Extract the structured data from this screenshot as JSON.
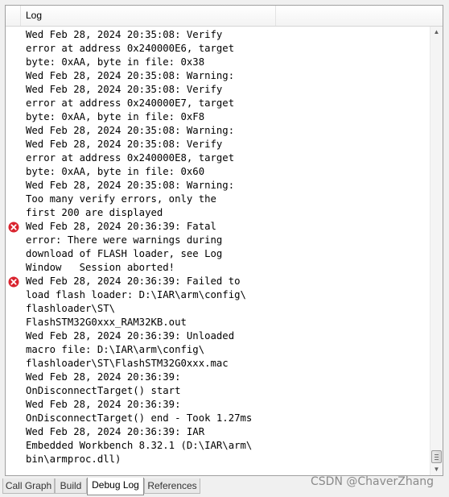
{
  "header": {
    "column_title": "Log"
  },
  "log": {
    "lines": [
      "Wed Feb 28, 2024 20:35:08: Verify",
      "error at address 0x240000E6, target",
      "byte: 0xAA, byte in file: 0x38",
      "Wed Feb 28, 2024 20:35:08: Warning:",
      "Wed Feb 28, 2024 20:35:08: Verify",
      "error at address 0x240000E7, target",
      "byte: 0xAA, byte in file: 0xF8",
      "Wed Feb 28, 2024 20:35:08: Warning:",
      "Wed Feb 28, 2024 20:35:08: Verify",
      "error at address 0x240000E8, target",
      "byte: 0xAA, byte in file: 0x60",
      "Wed Feb 28, 2024 20:35:08: Warning:",
      "Too many verify errors, only the",
      "first 200 are displayed",
      "Wed Feb 28, 2024 20:36:39: Fatal",
      "error: There were warnings during",
      "download of FLASH loader, see Log",
      "Window   Session aborted!",
      "Wed Feb 28, 2024 20:36:39: Failed to",
      "load flash loader: D:\\IAR\\arm\\config\\",
      "flashloader\\ST\\",
      "FlashSTM32G0xxx_RAM32KB.out",
      "Wed Feb 28, 2024 20:36:39: Unloaded",
      "macro file: D:\\IAR\\arm\\config\\",
      "flashloader\\ST\\FlashSTM32G0xxx.mac",
      "Wed Feb 28, 2024 20:36:39:",
      "OnDisconnectTarget() start",
      "Wed Feb 28, 2024 20:36:39:",
      "OnDisconnectTarget() end - Took 1.27ms",
      "Wed Feb 28, 2024 20:36:39: IAR",
      "Embedded Workbench 8.32.1 (D:\\IAR\\arm\\",
      "bin\\armproc.dll)"
    ],
    "error_icon_lines": [
      14,
      18
    ],
    "error_icon_name": "error-circle-icon",
    "error_color": "#d9232e"
  },
  "tabs": [
    {
      "label": "Call Graph",
      "active": false
    },
    {
      "label": "Build",
      "active": false
    },
    {
      "label": "Debug Log",
      "active": true
    },
    {
      "label": "References",
      "active": false
    }
  ],
  "watermark": "CSDN @ChaverZhang"
}
